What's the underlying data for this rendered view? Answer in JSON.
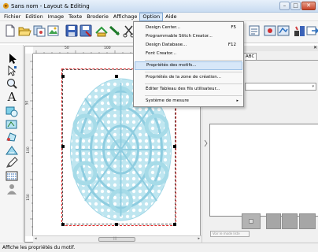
{
  "window": {
    "title": "Sans nom - Layout & Editing",
    "controls": {
      "minimize": "–",
      "maximize": "□",
      "close": "✕"
    }
  },
  "menubar": {
    "items": [
      "Fichier",
      "Edition",
      "Image",
      "Texte",
      "Broderie",
      "Affichage",
      "Option",
      "Aide"
    ],
    "active": "Option"
  },
  "option_menu": {
    "items": [
      {
        "label": "Design Center...",
        "shortcut": "F5"
      },
      {
        "label": "Programmable Stitch Creator...",
        "shortcut": ""
      },
      {
        "label": "Design Database...",
        "shortcut": "F12"
      },
      {
        "label": "Font Creator...",
        "shortcut": ""
      },
      {
        "label": "Propriétés des motifs...",
        "shortcut": ""
      },
      {
        "label": "Propriétés de la zone de création...",
        "shortcut": ""
      },
      {
        "label": "Éditer Tableau des fils utilisateur...",
        "shortcut": ""
      },
      {
        "label": "Système de mesure",
        "shortcut": "",
        "submenu": "▸"
      }
    ],
    "highlighted": "Propriétés des motifs..."
  },
  "rulers": {
    "horizontal": [
      "50",
      "100",
      "150"
    ],
    "vertical": [
      "50",
      "100",
      "150"
    ]
  },
  "right_panel": {
    "close": "✕",
    "tab_label": "ABC",
    "select_arrow": "▾",
    "view_button": "Voir le mode liste"
  },
  "scrollbar": {
    "left_arrow": "◂",
    "right_arrow": "▸",
    "grip": "|||"
  },
  "statusbar": {
    "text": "Affiche les propriétés du motif."
  },
  "colors": {
    "doily": "#a6dbe8",
    "hoop_border": "#e02020",
    "menu_highlight": "#d7e7f8"
  }
}
